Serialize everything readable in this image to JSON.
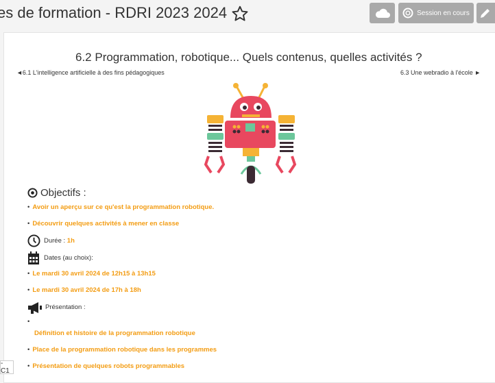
{
  "header": {
    "title": "es de formation - RDRI 2023 2024",
    "session_label": "Session en cours"
  },
  "page": {
    "title": "6.2 Programmation, robotique... Quels contenus, quelles activités ?",
    "prev_link": "◄6.1 L'intelligence artificielle à des fins pédagogiques",
    "next_link": "6.3 Une webradio à l'école ►"
  },
  "content": {
    "objectifs_heading": "Objectifs :",
    "objectifs": [
      "Avoir un aperçu sur ce qu'est la programmation robotique.",
      "Découvrir quelques activités à mener en classe"
    ],
    "duree_label": "Durée : ",
    "duree_value": "1h",
    "dates_label": "Dates  (au choix):",
    "dates": [
      "Le mardi 30 avril 2024 de 12h15 à 13h15",
      "Le mardi 30 avril 2024 de 17h à 18h"
    ],
    "presentation_label": "Présentation :",
    "presentation_items": [
      "Définition et histoire de la programmation robotique",
      "Place de la programmation robotique dans les programmes",
      "Présentation de quelques robots programmables"
    ]
  },
  "corner_label": "-C1",
  "colors": {
    "accent": "#f39c12",
    "button_bg": "#a9a9a9",
    "robot_red": "#e8485f",
    "robot_yellow": "#f5b335",
    "robot_dark": "#3b2a33",
    "robot_green": "#6cc79b"
  },
  "icons": {
    "star": "star-outline-icon",
    "cloud": "cloud-icon",
    "session": "session-ring-icon",
    "edit": "pencil-icon",
    "objectifs": "target-icon",
    "duree": "clock-icon",
    "dates": "calendar-icon",
    "presentation": "megaphone-icon"
  }
}
